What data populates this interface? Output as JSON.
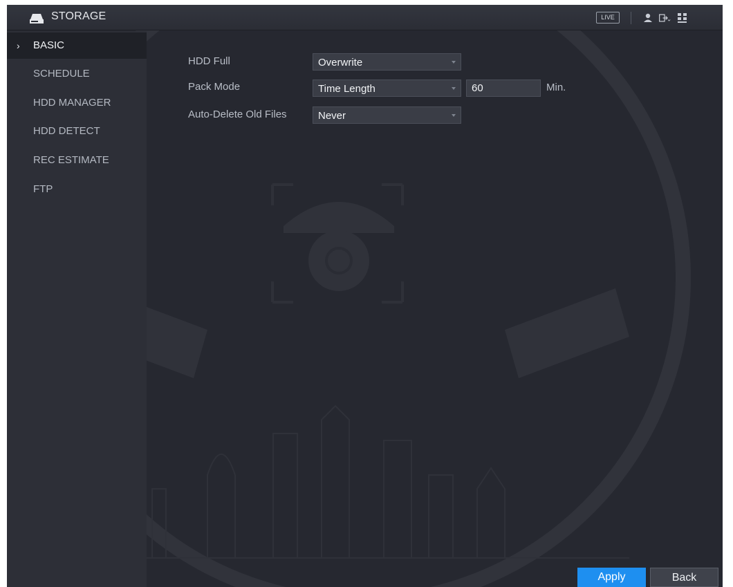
{
  "header": {
    "title": "STORAGE",
    "live_label": "LIVE",
    "icons": [
      "storage-icon",
      "user-icon",
      "logout-icon",
      "menu-grid-icon"
    ]
  },
  "sidebar": {
    "items": [
      {
        "label": "BASIC",
        "active": true
      },
      {
        "label": "SCHEDULE",
        "active": false
      },
      {
        "label": "HDD MANAGER",
        "active": false
      },
      {
        "label": "HDD DETECT",
        "active": false
      },
      {
        "label": "REC ESTIMATE",
        "active": false
      },
      {
        "label": "FTP",
        "active": false
      }
    ]
  },
  "form": {
    "hdd_full": {
      "label": "HDD Full",
      "value": "Overwrite"
    },
    "pack_mode": {
      "label": "Pack Mode",
      "value": "Time Length",
      "length_value": "60",
      "unit": "Min."
    },
    "auto_delete": {
      "label": "Auto-Delete Old Files",
      "value": "Never"
    }
  },
  "footer": {
    "apply_label": "Apply",
    "back_label": "Back"
  },
  "colors": {
    "background": "#262830",
    "sidebar": "#2d2f37",
    "active_item": "#1f2127",
    "accent": "#1e8ff0"
  }
}
